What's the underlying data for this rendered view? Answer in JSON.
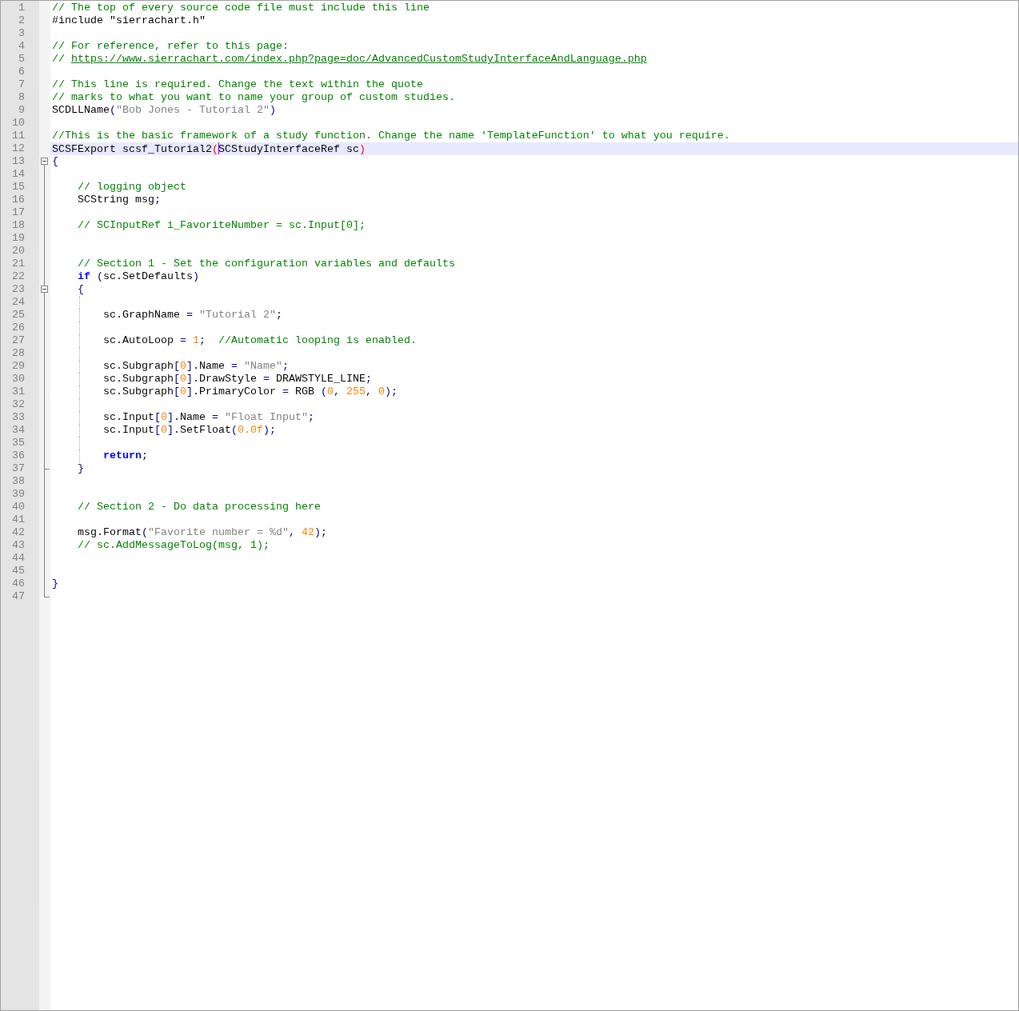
{
  "editor": {
    "lines": [
      {
        "number": "1",
        "tokens": [
          {
            "kind": "comment",
            "text": "// The top of every source code file must include this line"
          }
        ]
      },
      {
        "number": "2",
        "tokens": [
          {
            "kind": "plain",
            "text": "#include \"sierrachart.h\""
          }
        ]
      },
      {
        "number": "3"
      },
      {
        "number": "4",
        "tokens": [
          {
            "kind": "comment",
            "text": "// For reference, refer to this page:"
          }
        ]
      },
      {
        "number": "5",
        "tokens": [
          {
            "kind": "comment",
            "text": "// "
          },
          {
            "kind": "link",
            "text": "https://www.sierrachart.com/index.php?page=doc/AdvancedCustomStudyInterfaceAndLanguage.php"
          }
        ]
      },
      {
        "number": "6"
      },
      {
        "number": "7",
        "tokens": [
          {
            "kind": "comment",
            "text": "// This line is required. Change the text within the quote"
          }
        ]
      },
      {
        "number": "8",
        "tokens": [
          {
            "kind": "comment",
            "text": "// marks to what you want to name your group of custom studies."
          }
        ]
      },
      {
        "number": "9",
        "tokens": [
          {
            "kind": "plain",
            "text": "SCDLLName"
          },
          {
            "kind": "operator",
            "text": "("
          },
          {
            "kind": "string",
            "text": "\"Bob Jones - Tutorial 2\""
          },
          {
            "kind": "operator",
            "text": ")"
          }
        ]
      },
      {
        "number": "10"
      },
      {
        "number": "11",
        "tokens": [
          {
            "kind": "comment",
            "text": "//This is the basic framework of a study function. Change the name 'TemplateFunction' to what you require."
          }
        ]
      },
      {
        "number": "12",
        "current": true,
        "tokens": [
          {
            "kind": "plain",
            "text": "SCSFExport scsf_Tutorial2"
          },
          {
            "kind": "brace",
            "text": "("
          },
          {
            "kind": "plain",
            "text": "SCStudyInterfaceRef sc",
            "caret_before": true
          },
          {
            "kind": "brace",
            "text": ")"
          }
        ]
      },
      {
        "number": "13",
        "fold_open": true,
        "tokens": [
          {
            "kind": "operator",
            "text": "{"
          }
        ]
      },
      {
        "number": "14",
        "folded_region": true
      },
      {
        "number": "15",
        "folded_region": true,
        "tokens": [
          {
            "kind": "comment",
            "text": "    // logging object"
          }
        ]
      },
      {
        "number": "16",
        "folded_region": true,
        "tokens": [
          {
            "kind": "plain",
            "text": "    SCString msg"
          },
          {
            "kind": "operator",
            "text": ";"
          }
        ]
      },
      {
        "number": "17",
        "folded_region": true
      },
      {
        "number": "18",
        "folded_region": true,
        "tokens": [
          {
            "kind": "comment",
            "text": "    // SCInputRef i_FavoriteNumber = sc.Input[0];"
          }
        ]
      },
      {
        "number": "19",
        "folded_region": true
      },
      {
        "number": "20",
        "folded_region": true
      },
      {
        "number": "21",
        "folded_region": true,
        "tokens": [
          {
            "kind": "comment",
            "text": "    // Section 1 - Set the configuration variables and defaults"
          }
        ]
      },
      {
        "number": "22",
        "folded_region": true,
        "tokens": [
          {
            "kind": "keyword",
            "text": "    if"
          },
          {
            "kind": "operator",
            "text": " ("
          },
          {
            "kind": "plain",
            "text": "sc.SetDefaults"
          },
          {
            "kind": "operator",
            "text": ")"
          }
        ]
      },
      {
        "number": "23",
        "folded_region": true,
        "fold_open": true,
        "tokens": [
          {
            "kind": "operator",
            "text": "    {"
          }
        ]
      },
      {
        "number": "24",
        "folded_region": true,
        "indent_guide": true
      },
      {
        "number": "25",
        "folded_region": true,
        "indent_guide": true,
        "tokens": [
          {
            "kind": "plain",
            "text": "        sc.GraphName "
          },
          {
            "kind": "operator",
            "text": "= "
          },
          {
            "kind": "string",
            "text": "\"Tutorial 2\""
          },
          {
            "kind": "operator",
            "text": ";"
          }
        ]
      },
      {
        "number": "26",
        "folded_region": true,
        "indent_guide": true
      },
      {
        "number": "27",
        "folded_region": true,
        "indent_guide": true,
        "tokens": [
          {
            "kind": "plain",
            "text": "        sc.AutoLoop "
          },
          {
            "kind": "operator",
            "text": "= "
          },
          {
            "kind": "number",
            "text": "1"
          },
          {
            "kind": "operator",
            "text": ";"
          },
          {
            "kind": "comment",
            "text": "  //Automatic looping is enabled."
          }
        ]
      },
      {
        "number": "28",
        "folded_region": true,
        "indent_guide": true
      },
      {
        "number": "29",
        "folded_region": true,
        "indent_guide": true,
        "tokens": [
          {
            "kind": "plain",
            "text": "        sc.Subgraph"
          },
          {
            "kind": "operator",
            "text": "["
          },
          {
            "kind": "number",
            "text": "0"
          },
          {
            "kind": "operator",
            "text": "]"
          },
          {
            "kind": "plain",
            "text": ".Name "
          },
          {
            "kind": "operator",
            "text": "= "
          },
          {
            "kind": "string",
            "text": "\"Name\""
          },
          {
            "kind": "operator",
            "text": ";"
          }
        ]
      },
      {
        "number": "30",
        "folded_region": true,
        "indent_guide": true,
        "tokens": [
          {
            "kind": "plain",
            "text": "        sc.Subgraph"
          },
          {
            "kind": "operator",
            "text": "["
          },
          {
            "kind": "number",
            "text": "0"
          },
          {
            "kind": "operator",
            "text": "]"
          },
          {
            "kind": "plain",
            "text": ".DrawStyle "
          },
          {
            "kind": "operator",
            "text": "="
          },
          {
            "kind": "plain",
            "text": " DRAWSTYLE_LINE"
          },
          {
            "kind": "operator",
            "text": ";"
          }
        ]
      },
      {
        "number": "31",
        "folded_region": true,
        "indent_guide": true,
        "tokens": [
          {
            "kind": "plain",
            "text": "        sc.Subgraph"
          },
          {
            "kind": "operator",
            "text": "["
          },
          {
            "kind": "number",
            "text": "0"
          },
          {
            "kind": "operator",
            "text": "]"
          },
          {
            "kind": "plain",
            "text": ".PrimaryColor "
          },
          {
            "kind": "operator",
            "text": "="
          },
          {
            "kind": "plain",
            "text": " RGB "
          },
          {
            "kind": "operator",
            "text": "("
          },
          {
            "kind": "number",
            "text": "0"
          },
          {
            "kind": "operator",
            "text": ", "
          },
          {
            "kind": "number",
            "text": "255"
          },
          {
            "kind": "operator",
            "text": ", "
          },
          {
            "kind": "number",
            "text": "0"
          },
          {
            "kind": "operator",
            "text": ");"
          }
        ]
      },
      {
        "number": "32",
        "folded_region": true,
        "indent_guide": true
      },
      {
        "number": "33",
        "folded_region": true,
        "indent_guide": true,
        "tokens": [
          {
            "kind": "plain",
            "text": "        sc.Input"
          },
          {
            "kind": "operator",
            "text": "["
          },
          {
            "kind": "number",
            "text": "0"
          },
          {
            "kind": "operator",
            "text": "]"
          },
          {
            "kind": "plain",
            "text": ".Name "
          },
          {
            "kind": "operator",
            "text": "= "
          },
          {
            "kind": "string",
            "text": "\"Float Input\""
          },
          {
            "kind": "operator",
            "text": ";"
          }
        ]
      },
      {
        "number": "34",
        "folded_region": true,
        "indent_guide": true,
        "tokens": [
          {
            "kind": "plain",
            "text": "        sc.Input"
          },
          {
            "kind": "operator",
            "text": "["
          },
          {
            "kind": "number",
            "text": "0"
          },
          {
            "kind": "operator",
            "text": "]"
          },
          {
            "kind": "plain",
            "text": ".SetFloat"
          },
          {
            "kind": "operator",
            "text": "("
          },
          {
            "kind": "number",
            "text": "0.0f"
          },
          {
            "kind": "operator",
            "text": ");"
          }
        ]
      },
      {
        "number": "35",
        "folded_region": true,
        "indent_guide": true
      },
      {
        "number": "36",
        "folded_region": true,
        "indent_guide": true,
        "tokens": [
          {
            "kind": "keyword",
            "text": "        return"
          },
          {
            "kind": "operator",
            "text": ";"
          }
        ]
      },
      {
        "number": "37",
        "folded_region": true,
        "fold_close": true,
        "tokens": [
          {
            "kind": "operator",
            "text": "    }"
          }
        ]
      },
      {
        "number": "38",
        "folded_region": true
      },
      {
        "number": "39",
        "folded_region": true
      },
      {
        "number": "40",
        "folded_region": true,
        "tokens": [
          {
            "kind": "comment",
            "text": "    // Section 2 - Do data processing here"
          }
        ]
      },
      {
        "number": "41",
        "folded_region": true
      },
      {
        "number": "42",
        "folded_region": true,
        "tokens": [
          {
            "kind": "plain",
            "text": "    msg.Format"
          },
          {
            "kind": "operator",
            "text": "("
          },
          {
            "kind": "string",
            "text": "\"Favorite number = %d\""
          },
          {
            "kind": "operator",
            "text": ", "
          },
          {
            "kind": "number",
            "text": "42"
          },
          {
            "kind": "operator",
            "text": ");"
          }
        ]
      },
      {
        "number": "43",
        "folded_region": true,
        "tokens": [
          {
            "kind": "comment",
            "text": "    // sc.AddMessageToLog(msg, 1);"
          }
        ]
      },
      {
        "number": "44",
        "folded_region": true
      },
      {
        "number": "45",
        "folded_region": true
      },
      {
        "number": "46",
        "folded_region": true,
        "tokens": [
          {
            "kind": "operator",
            "text": "}"
          }
        ]
      },
      {
        "number": "47",
        "fold_close": true
      }
    ]
  }
}
